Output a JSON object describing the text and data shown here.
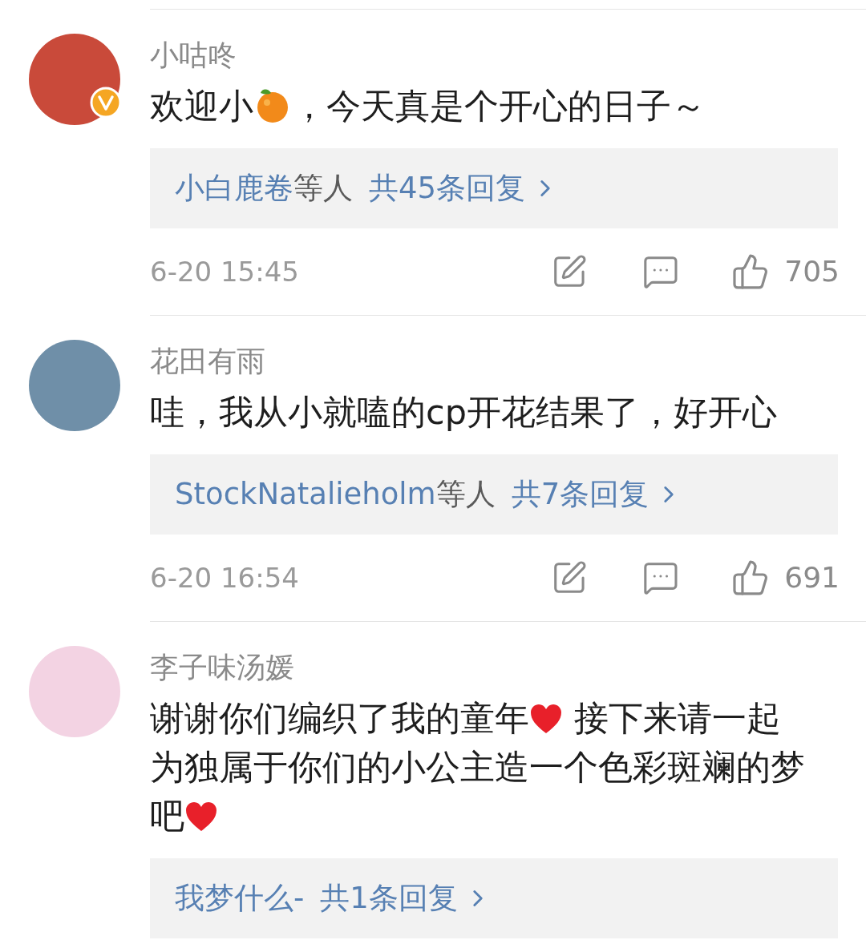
{
  "comments": [
    {
      "user": "小咕咚",
      "verified": true,
      "text": [
        {
          "kind": "text",
          "value": "欢迎小"
        },
        {
          "kind": "orange"
        },
        {
          "kind": "text",
          "value": "，今天真是个开心的日子～"
        }
      ],
      "replies": {
        "names": "小白鹿卷",
        "others": "等人",
        "total": "共45条回复"
      },
      "time": "6-20 15:45",
      "likes": "705"
    },
    {
      "user": "花田有雨",
      "verified": false,
      "text": [
        {
          "kind": "text",
          "value": "哇，我从小就嗑的cp开花结果了，好开心"
        }
      ],
      "replies": {
        "names": "StockNatalieholm",
        "others": "等人",
        "total": "共7条回复"
      },
      "time": "6-20 16:54",
      "likes": "691"
    },
    {
      "user": "李子味汤媛",
      "verified": false,
      "text": [
        {
          "kind": "text",
          "value": "谢谢你们编织了我的童年"
        },
        {
          "kind": "heart"
        },
        {
          "kind": "text",
          "value": " 接下来请一起"
        },
        {
          "kind": "break"
        },
        {
          "kind": "text",
          "value": "为独属于你们的小公主造一个色彩斑斓的梦"
        },
        {
          "kind": "break"
        },
        {
          "kind": "text",
          "value": "吧"
        },
        {
          "kind": "heart"
        }
      ],
      "replies": {
        "names": "我梦什么-",
        "total": "共1条回复"
      }
    }
  ]
}
